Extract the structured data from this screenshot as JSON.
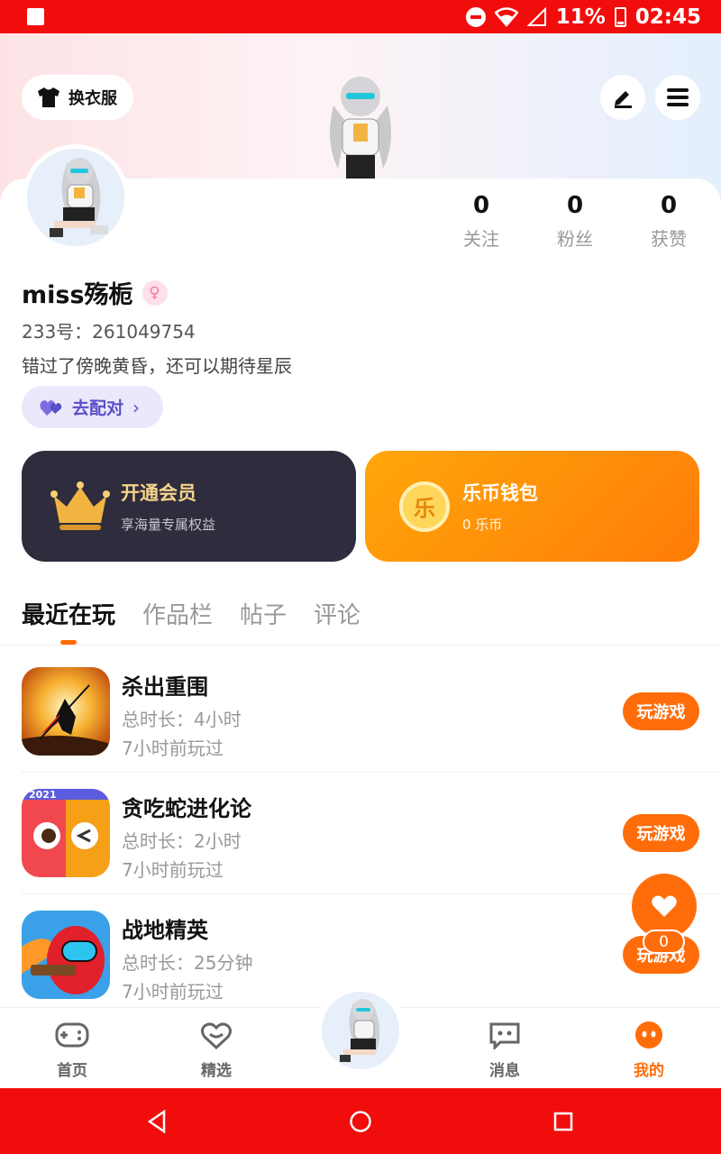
{
  "status_bar": {
    "battery": "11%",
    "time": "02:45"
  },
  "header": {
    "wardrobe_label": "换衣服"
  },
  "profile": {
    "stats": [
      {
        "count": "0",
        "label": "关注"
      },
      {
        "count": "0",
        "label": "粉丝"
      },
      {
        "count": "0",
        "label": "获赞"
      }
    ],
    "username": "miss殇栀",
    "uid": "233号：261049754",
    "bio": "错过了傍晚黄昏，还可以期待星辰",
    "match_label": "去配对"
  },
  "cards": {
    "vip": {
      "title": "开通会员",
      "subtitle": "享海量专属权益"
    },
    "wallet": {
      "icon_text": "乐",
      "title": "乐币钱包",
      "subtitle": "0 乐币"
    }
  },
  "tabs": [
    "最近在玩",
    "作品栏",
    "帖子",
    "评论"
  ],
  "games": [
    {
      "name": "杀出重围",
      "duration": "总时长：4小时",
      "last_played": "7小时前玩过",
      "button": "玩游戏",
      "icon_badge": ""
    },
    {
      "name": "贪吃蛇进化论",
      "duration": "总时长：2小时",
      "last_played": "7小时前玩过",
      "button": "玩游戏",
      "icon_badge": "2021"
    },
    {
      "name": "战地精英",
      "duration": "总时长：25分钟",
      "last_played": "7小时前玩过",
      "button": "玩游戏",
      "icon_badge": ""
    }
  ],
  "fab": {
    "count": "0"
  },
  "bottom_nav": [
    {
      "label": "首页",
      "icon": "gamepad-icon"
    },
    {
      "label": "精选",
      "icon": "heart-chat-icon"
    },
    {
      "label": "消息",
      "icon": "message-icon"
    },
    {
      "label": "我的",
      "icon": "face-icon"
    }
  ],
  "colors": {
    "accent": "#ff6d0a",
    "status_bar": "#f20d0d",
    "vip_card": "#2e2c3d",
    "match": "#5a4fc9"
  }
}
